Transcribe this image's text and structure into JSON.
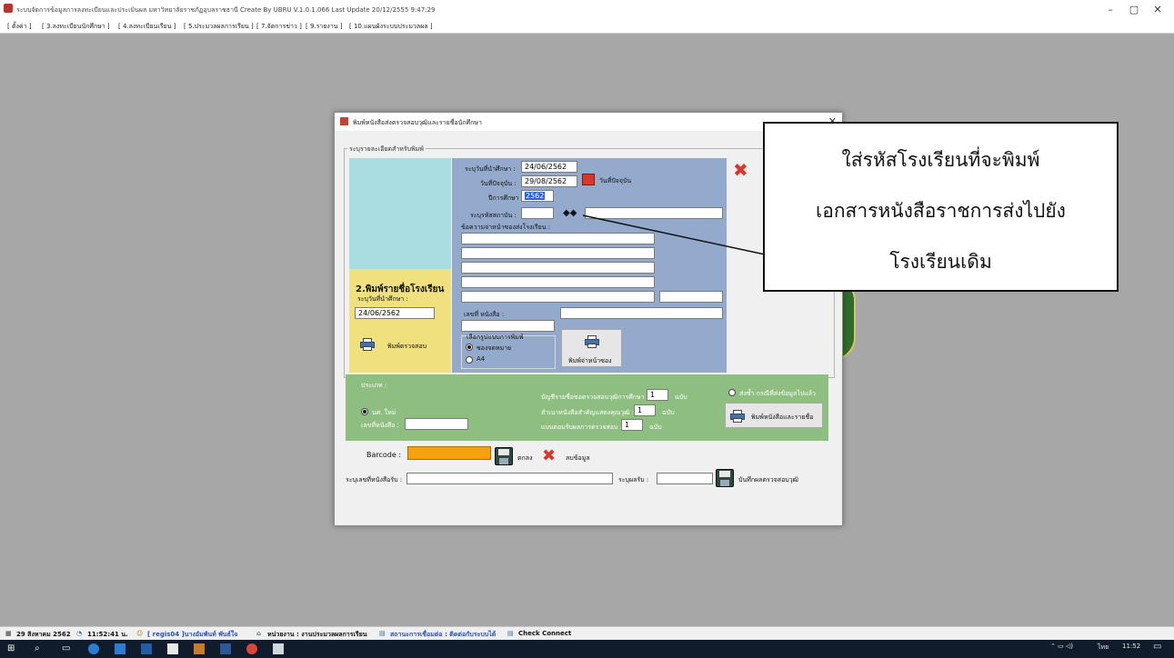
{
  "window": {
    "title": "ระบบจัดการข้อมูลการลงทะเบียนและประเมินผล มหาวิทยาลัยราชภัฏอุบลราชธานี Create By UBRU   V.1.0.1.066 Last Update 20/12/2555 9:47:29",
    "minimize": "–",
    "maximize": "▢",
    "close": "✕"
  },
  "menu": [
    "[ ตั้งค่า ]",
    "[ 3.ลงทะเบียนนักศึกษา ]",
    "[ 4.ลงทะเบียนเรียน ]",
    "[ 5.ประมวลผลการเรียน ]",
    "[ 7.จัดการข่าว ]",
    "[ 9.รายงาน ]",
    "[ 10.แผนผังระบบประมวลผล ]"
  ],
  "dialog": {
    "title": "พิมพ์หนังสือส่งตรวจสอบวุฒิและรายชื่อนักศึกษา",
    "close": "✕",
    "group_label": "ระบุรายละเอียดสำหรับพิมพ์",
    "date_label": "ระบุวันที่นำศึกษา :",
    "date_value": "24/06/2562",
    "today_label": "วันที่ปัจจุบัน :",
    "today_value": "29/08/2562",
    "today_button": "วันที่ปัจจุบัน",
    "year_label": "ปีการศึกษา :",
    "year_value": "2562",
    "school_code_label": "ระบุรหัสสถาบัน :",
    "school_code_value": "",
    "school_name_value": "",
    "address_label": "ข้อความจ่าหน้าซองส่งโรงเรียน :",
    "doc_no_label": "เลขที่ หนังสือ :",
    "print_format_label": "เลือกรูปแบบการพิมพ์",
    "format_envelope": "ซองจดหมาย",
    "format_a4": "A4",
    "print_envelope_button": "พิมพ์จ่าหน้าซอง",
    "section2_title": "2.พิมพ์รายชื่อโรงเรียน",
    "section2_date_label": "ระบุวันที่นำศึกษา :",
    "section2_date_value": "24/06/2562",
    "print_check_button": "พิมพ์ตรวจสอบ",
    "type_label": "ประเภท :",
    "type_new": "นศ. ใหม่",
    "doc_no_label2": "เลขที่หนังสือ :",
    "list_label": "บัญชีรายชื่อขอตรวจสอบวุฒิการศึกษา :",
    "list_value": "1",
    "copy_label": "สำเนาหนังสือสำคัญแสดงคุณวุฒิ :",
    "copy_value": "1",
    "form_label": "แบบตอบรับผลการตรวจสอบ :",
    "form_value": "1",
    "unit": "ฉบับ",
    "resend_label": "ส่งซ้ำ กรณีที่ส่งข้อมูลไปแล้ว",
    "print_all_button": "พิมพ์หนังสือและรายชื่อ",
    "barcode_label": "Barcode :",
    "barcode_value": "",
    "save_btn": "ตกลง",
    "delete_btn": "ลบข้อมูล",
    "reply_doc_label": "ระบุเลขที่หนังสือรับ :",
    "reply_date_label": "ระบุผลรับ :",
    "save_result_button": "บันทึกผลตรวจสอบวุฒิ"
  },
  "callout": {
    "line1": "ใส่รหัสโรงเรียนที่จะพิมพ์",
    "line2": "เอกสารหนังสือราชการส่งไปยัง",
    "line3": "โรงเรียนเดิม"
  },
  "status": {
    "date": "29 สิงหาคม 2562",
    "time": "11:52:41 น.",
    "user": "[ regis04 ]นางอัมพันท์ พันธ์ใจ",
    "unit": "หน่วยงาน : งานประมวลผลการเรียน",
    "connect_status": "สถานะการเชื่อมต่อ : ติดต่อกับระบบได้",
    "check": "Check Connect"
  },
  "taskbar": {
    "clock": "11:52",
    "lang": "ไทย"
  },
  "colors": {
    "blue_panel": "#93aacc",
    "yellow_panel": "#f0e17e",
    "green_panel": "#8fbf80",
    "barcode_fill": "#f4a20e"
  }
}
